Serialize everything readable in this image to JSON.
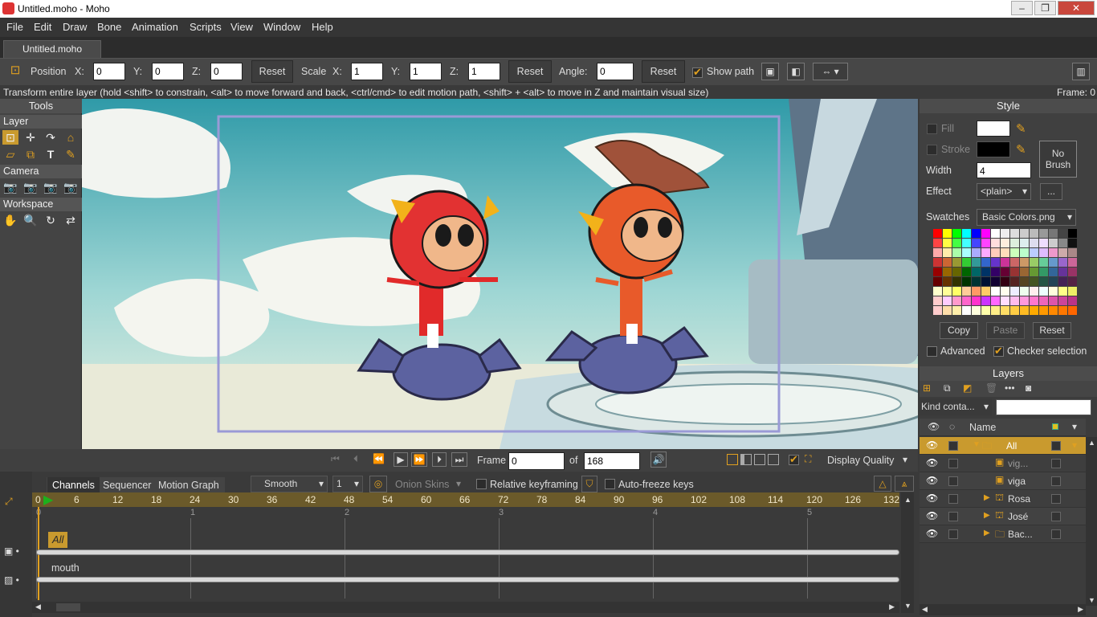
{
  "window": {
    "title": "Untitled.moho - Moho",
    "min": "–",
    "max": "❐",
    "close": "✕"
  },
  "menu": [
    "File",
    "Edit",
    "Draw",
    "Bone",
    "Animation",
    "Scripts",
    "View",
    "Window",
    "Help"
  ],
  "doc_tab": "Untitled.moho",
  "toolbar": {
    "position_label": "Position",
    "x_label": "X:",
    "y_label": "Y:",
    "z_label": "Z:",
    "pos_x": "0",
    "pos_y": "0",
    "pos_z": "0",
    "reset1": "Reset",
    "scale_label": "Scale",
    "scale_x": "1",
    "scale_y": "1",
    "scale_z": "1",
    "reset2": "Reset",
    "angle_label": "Angle:",
    "angle": "0",
    "reset3": "Reset",
    "show_path": "Show path"
  },
  "status": {
    "hint": "Transform entire layer (hold <shift> to constrain, <alt> to move forward and back, <ctrl/cmd> to edit motion path, <shift> + <alt> to move in Z and maintain visual size)",
    "frame": "Frame: 0"
  },
  "tools": {
    "title": "Tools",
    "layer": "Layer",
    "camera": "Camera",
    "workspace": "Workspace"
  },
  "style": {
    "title": "Style",
    "fill": "Fill",
    "stroke": "Stroke",
    "width_label": "Width",
    "width": "4",
    "no_brush": "No\nBrush",
    "effect_label": "Effect",
    "effect": "<plain>",
    "effect_more": "...",
    "swatches_label": "Swatches",
    "swatches": "Basic Colors.png",
    "copy": "Copy",
    "paste": "Paste",
    "reset": "Reset",
    "advanced": "Advanced",
    "checker": "Checker selection",
    "fill_color": "#ffffff",
    "stroke_color": "#000000"
  },
  "layers": {
    "title": "Layers",
    "kind": "Kind conta...",
    "name_col": "Name",
    "rows": [
      {
        "name": "All",
        "selected": true
      },
      {
        "name": "vig...",
        "selected": false
      },
      {
        "name": "viga",
        "selected": false
      },
      {
        "name": "Rosa",
        "selected": false
      },
      {
        "name": "José",
        "selected": false
      },
      {
        "name": "Bac...",
        "selected": false
      }
    ]
  },
  "playback": {
    "frame_label": "Frame",
    "frame": "0",
    "of_label": "of",
    "total": "168",
    "display_quality": "Display Quality"
  },
  "timeline": {
    "tabs": [
      "Channels",
      "Sequencer",
      "Motion Graph"
    ],
    "interp": "Smooth",
    "interp_num": "1",
    "onion": "Onion Skins",
    "relative": "Relative keyframing",
    "autofreeze": "Auto-freeze keys",
    "ticks": [
      "0",
      "6",
      "12",
      "18",
      "24",
      "30",
      "36",
      "42",
      "48",
      "54",
      "60",
      "66",
      "72",
      "78",
      "84",
      "90",
      "96",
      "102",
      "108",
      "114",
      "120",
      "126",
      "132"
    ],
    "seconds": [
      "0",
      "1",
      "2",
      "3",
      "4",
      "5"
    ],
    "track1": "All",
    "track2": "mouth"
  },
  "colors": {
    "accent": "#e0a020",
    "selection": "#c99a2e",
    "canvas_sky": "#5fb7c0"
  }
}
